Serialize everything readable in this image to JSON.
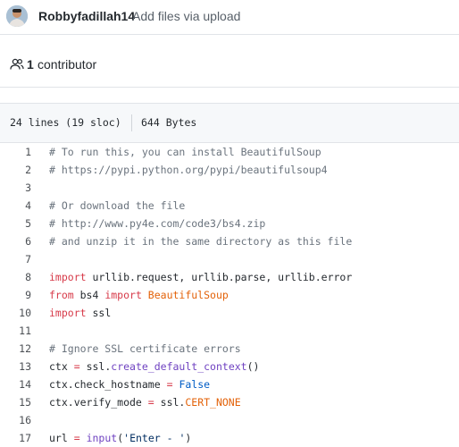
{
  "commit": {
    "author": "Robbyfadillah14",
    "message": "Add files via upload"
  },
  "contributors": {
    "count": "1",
    "label": "contributor"
  },
  "file_info": {
    "lines": "24 lines (19 sloc)",
    "size": "644 Bytes"
  },
  "code": [
    {
      "n": "1",
      "tokens": [
        {
          "t": "# To run this, you can install BeautifulSoup",
          "k": "comment"
        }
      ]
    },
    {
      "n": "2",
      "tokens": [
        {
          "t": "# https://pypi.python.org/pypi/beautifulsoup4",
          "k": "comment"
        }
      ]
    },
    {
      "n": "3",
      "tokens": []
    },
    {
      "n": "4",
      "tokens": [
        {
          "t": "# Or download the file",
          "k": "comment"
        }
      ]
    },
    {
      "n": "5",
      "tokens": [
        {
          "t": "# http://www.py4e.com/code3/bs4.zip",
          "k": "comment"
        }
      ]
    },
    {
      "n": "6",
      "tokens": [
        {
          "t": "# and unzip it in the same directory as this file",
          "k": "comment"
        }
      ]
    },
    {
      "n": "7",
      "tokens": []
    },
    {
      "n": "8",
      "tokens": [
        {
          "t": "import",
          "k": "kw"
        },
        {
          "t": " urllib.request, urllib.parse, urllib.error",
          "k": "name"
        }
      ]
    },
    {
      "n": "9",
      "tokens": [
        {
          "t": "from",
          "k": "kw"
        },
        {
          "t": " bs4 ",
          "k": "name"
        },
        {
          "t": "import",
          "k": "kw"
        },
        {
          "t": " BeautifulSoup",
          "k": "cls"
        }
      ]
    },
    {
      "n": "10",
      "tokens": [
        {
          "t": "import",
          "k": "kw"
        },
        {
          "t": " ssl",
          "k": "name"
        }
      ]
    },
    {
      "n": "11",
      "tokens": []
    },
    {
      "n": "12",
      "tokens": [
        {
          "t": "# Ignore SSL certificate errors",
          "k": "comment"
        }
      ]
    },
    {
      "n": "13",
      "tokens": [
        {
          "t": "ctx ",
          "k": "name"
        },
        {
          "t": "=",
          "k": "kw"
        },
        {
          "t": " ssl.",
          "k": "name"
        },
        {
          "t": "create_default_context",
          "k": "func"
        },
        {
          "t": "()",
          "k": "name"
        }
      ]
    },
    {
      "n": "14",
      "tokens": [
        {
          "t": "ctx.check_hostname ",
          "k": "name"
        },
        {
          "t": "=",
          "k": "kw"
        },
        {
          "t": " ",
          "k": "name"
        },
        {
          "t": "False",
          "k": "const"
        }
      ]
    },
    {
      "n": "15",
      "tokens": [
        {
          "t": "ctx.verify_mode ",
          "k": "name"
        },
        {
          "t": "=",
          "k": "kw"
        },
        {
          "t": " ssl.",
          "k": "name"
        },
        {
          "t": "CERT_NONE",
          "k": "cls"
        }
      ]
    },
    {
      "n": "16",
      "tokens": []
    },
    {
      "n": "17",
      "tokens": [
        {
          "t": "url ",
          "k": "name"
        },
        {
          "t": "=",
          "k": "kw"
        },
        {
          "t": " ",
          "k": "name"
        },
        {
          "t": "input",
          "k": "func"
        },
        {
          "t": "(",
          "k": "name"
        },
        {
          "t": "'Enter - '",
          "k": "str"
        },
        {
          "t": ")",
          "k": "name"
        }
      ]
    }
  ]
}
